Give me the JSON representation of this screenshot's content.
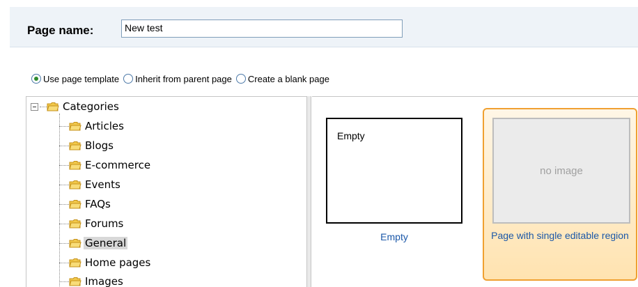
{
  "page_name": {
    "label": "Page name:",
    "value": "New test"
  },
  "radios": [
    {
      "label": "Use page template",
      "selected": true
    },
    {
      "label": "Inherit from parent page",
      "selected": false
    },
    {
      "label": "Create a blank page",
      "selected": false
    }
  ],
  "tree": {
    "root": {
      "label": "Categories",
      "icon": "folder-icon",
      "expanded": true
    },
    "items": [
      {
        "label": "Articles"
      },
      {
        "label": "Blogs"
      },
      {
        "label": "E-commerce"
      },
      {
        "label": "Events"
      },
      {
        "label": "FAQs"
      },
      {
        "label": "Forums"
      },
      {
        "label": "General",
        "selected": true
      },
      {
        "label": "Home pages"
      },
      {
        "label": "Images"
      }
    ]
  },
  "templates": [
    {
      "thumb_text": "Empty",
      "caption": "Empty",
      "selected": false
    },
    {
      "thumb_text": "no image",
      "caption": "Page with single editable region",
      "selected": true
    }
  ],
  "colors": {
    "accent": "#f0a030",
    "link": "#1a57a8",
    "header_bg": "#eef3f8",
    "radio_dot": "#2e8b2e"
  }
}
